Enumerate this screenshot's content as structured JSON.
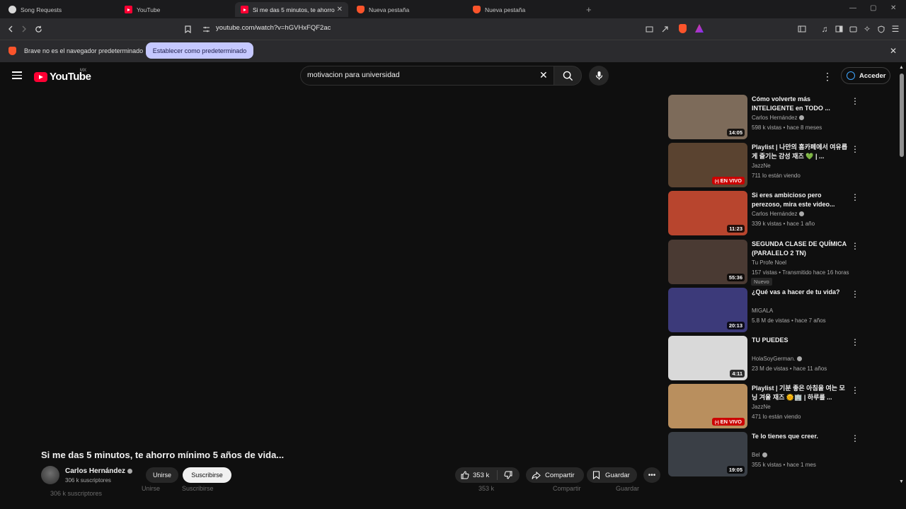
{
  "browser": {
    "tabs": [
      {
        "label": "Song Requests",
        "icon": "twitch-icon"
      },
      {
        "label": "YouTube",
        "icon": "youtube-icon"
      },
      {
        "label": "Si me das 5 minutos, te ahorro mínimo 5 años de vida...",
        "icon": "youtube-icon",
        "active": true
      },
      {
        "label": "Nueva pestaña",
        "icon": "brave-icon"
      },
      {
        "label": "Nueva pestaña",
        "icon": "brave-icon"
      }
    ],
    "url": "youtube.com/watch?v=hGVHxFQF2ac",
    "window_controls": {
      "minimize": "—",
      "maximize": "▢",
      "close": "✕"
    },
    "infobar": {
      "message": "Brave no es el navegador predeterminado",
      "button": "Establecer como predeterminado"
    }
  },
  "youtube": {
    "logo_text": "YouTube",
    "region": "MX",
    "search_value": "motivacion para universidad",
    "signin_label": "Acceder"
  },
  "video": {
    "title": "Si me das 5 minutos, te ahorro mínimo 5 años de vida...",
    "channel": "Carlos Hernández",
    "subscribers": "306 k suscriptores",
    "join_label": "Unirse",
    "subscribe_label": "Suscribirse",
    "likes": "353 k",
    "share_label": "Compartir",
    "save_label": "Guardar"
  },
  "recommendations": [
    {
      "title": "Cómo volverte más INTELIGENTE en TODO ...",
      "channel": "Carlos Hernández",
      "verified": true,
      "meta": "598 k vistas • hace 8 meses",
      "duration": "14:05",
      "live": false,
      "thumb_color": "#7d6b5a"
    },
    {
      "title": "Playlist | 나만의 홈카페에서 여유롭게 즐기는 감성 재즈 💚 | ...",
      "channel": "JazzNe",
      "verified": false,
      "meta": "711 lo están viendo",
      "duration": "EN VIVO",
      "live": true,
      "thumb_color": "#5a4330"
    },
    {
      "title": "Si eres ambicioso pero perezoso, mira este video...",
      "channel": "Carlos Hernández",
      "verified": true,
      "meta": "339 k vistas • hace 1 año",
      "duration": "11:23",
      "live": false,
      "thumb_color": "#b8452e"
    },
    {
      "title": "SEGUNDA CLASE DE QUÍMICA (PARALELO 2 TN)",
      "channel": "Tu Profe Noel",
      "verified": false,
      "meta": "157 vistas • Transmitido hace 16 horas",
      "badge": "Nuevo",
      "duration": "55:36",
      "live": false,
      "thumb_color": "#4a3a33"
    },
    {
      "title": "¿Qué vas a hacer de tu vida?",
      "channel": "MIGALA",
      "verified": false,
      "meta": "5.8 M de vistas • hace 7 años",
      "duration": "20:13",
      "live": false,
      "thumb_color": "#3c3a7a"
    },
    {
      "title": "TU PUEDES",
      "channel": "HolaSoyGerman.",
      "verified": true,
      "meta": "23 M de vistas • hace 11 años",
      "duration": "4:11",
      "live": false,
      "thumb_color": "#d9d9d9"
    },
    {
      "title": "Playlist | 기분 좋은 아침을 여는 모닝 겨울 재즈 🌞🏢 | 하루를 ...",
      "channel": "JazzNe",
      "verified": false,
      "meta": "471 lo están viendo",
      "duration": "EN VIVO",
      "live": true,
      "thumb_color": "#b98f5e"
    },
    {
      "title": "Te lo tienes que creer.",
      "channel": "Bel",
      "verified": true,
      "meta": "355 k vistas • hace 1 mes",
      "duration": "19:05",
      "live": false,
      "thumb_color": "#3a3f46"
    }
  ]
}
